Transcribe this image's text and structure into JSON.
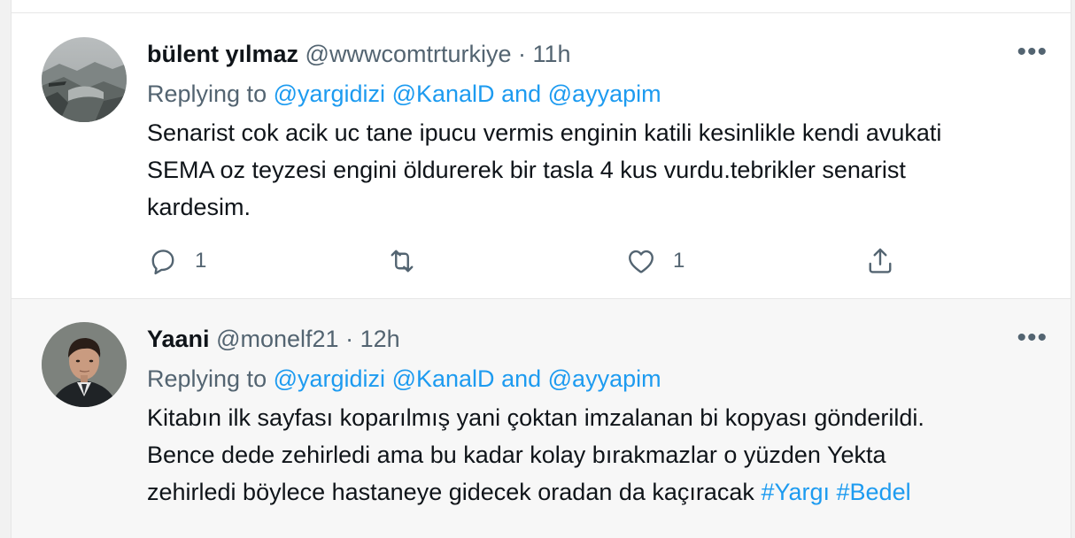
{
  "tweets": [
    {
      "author_name": "bülent yılmaz",
      "handle": "@wwwcomtrturkiye",
      "separator": "·",
      "time": "11h",
      "more": "•••",
      "replying_prefix": "Replying to",
      "mention_1": "@yargidizi",
      "mention_2": "@KanalD",
      "conjunction": "and",
      "mention_3": "@ayyapim",
      "text_lines": [
        "Senarist cok acik uc tane ipucu vermis enginin katili kesinlikle kendi avukati",
        "SEMA oz teyzesi engini öldurerek bir tasla 4 kus vurdu.tebrikler senarist",
        "kardesim."
      ],
      "reply_count": "1",
      "retweet_count": "",
      "like_count": "1"
    },
    {
      "author_name": "Yaani",
      "handle": "@monelf21",
      "separator": "·",
      "time": "12h",
      "more": "•••",
      "replying_prefix": "Replying to",
      "mention_1": "@yargidizi",
      "mention_2": "@KanalD",
      "conjunction": "and",
      "mention_3": "@ayyapim",
      "text_lines": [
        "Kitabın ilk sayfası koparılmış yani çoktan imzalanan bi kopyası gönderildi.",
        "Bence dede zehirledi ama bu kadar kolay bırakmazlar o yüzden Yekta",
        "zehirledi böylece hastaneye gidecek oradan da kaçıracak"
      ],
      "hashtag_1": "#Yargı",
      "hashtag_2": "#Bedel"
    }
  ],
  "icons": {
    "reply": "speech-bubble-icon",
    "retweet": "retweet-arrows-icon",
    "like": "heart-icon",
    "share": "share-upload-icon",
    "more": "more-dots-icon"
  },
  "colors": {
    "link": "#1d9bf0",
    "secondary_text": "#536471",
    "primary_text": "#0f1419"
  }
}
